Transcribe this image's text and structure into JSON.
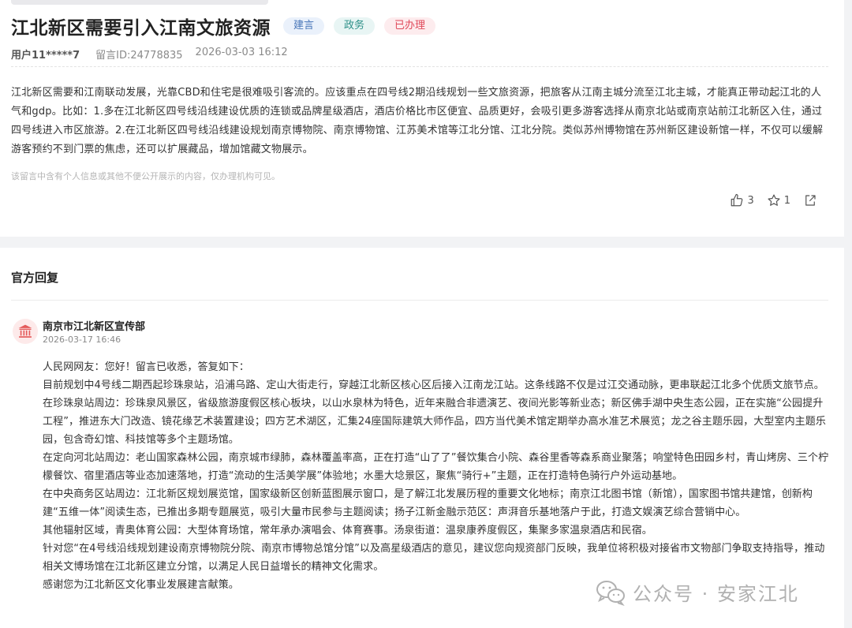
{
  "post": {
    "title": "江北新区需要引入江南文旅资源",
    "tags": [
      "建言",
      "政务",
      "已办理"
    ],
    "user": "用户11*****7",
    "message_id": "留言ID:24778835",
    "datetime": "2026-03-03 16:12",
    "content": "江北新区需要和江南联动发展，光靠CBD和住宅是很难吸引客流的。应该重点在四号线2期沿线规划一些文旅资源，把旅客从江南主城分流至江北主城，才能真正带动起江北的人气和gdp。比如：1.多在江北新区四号线沿线建设优质的连锁或品牌星级酒店，酒店价格比市区便宜、品质更好，会吸引更多游客选择从南京北站或南京站前江北新区入住，通过四号线进入市区旅游。2.在江北新区四号线沿线建设规划南京博物院、南京博物馆、江苏美术馆等江北分馆、江北分院。类似苏州博物馆在苏州新区建设新馆一样，不仅可以缓解游客预约不到门票的焦虑，还可以扩展藏品，增加馆藏文物展示。",
    "notice": "该留言中含有个人信息或其他不便公开展示的内容，仅办理机构可见。",
    "likes": "3",
    "favorites": "1"
  },
  "reply": {
    "section_title": "官方回复",
    "org": "南京市江北新区宣传部",
    "datetime": "2026-03-17 16:46",
    "paragraphs": [
      "人民网网友：您好！留言已收悉，答复如下：",
      "目前规划中4号线二期西起珍珠泉站，沿浦乌路、定山大街走行，穿越江北新区核心区后接入江南龙江站。这条线路不仅是过江交通动脉，更串联起江北多个优质文旅节点。",
      "在珍珠泉站周边：珍珠泉风景区，省级旅游度假区核心板块，以山水泉林为特色，近年来融合非遗演艺、夜间光影等新业态；新区佛手湖中央生态公园，正在实施“公园提升工程”，推进东大门改造、镜花缘艺术装置建设；四方艺术湖区，汇集24座国际建筑大师作品，四方当代美术馆定期举办高水准艺术展览；龙之谷主题乐园，大型室内主题乐园，包含奇幻馆、科技馆等多个主题场馆。",
      "在定向河北站周边：老山国家森林公园，南京城市绿肺，森林覆盖率高，正在打造“山了了”餐饮集合小院、森谷里香等森系商业聚落；响堂特色田园乡村，青山烤房、三个柠檬餐饮、宿里酒店等业态加速落地，打造“流动的生活美学展”体验地；水墨大埝景区，聚焦“骑行+”主题，正在打造特色骑行户外运动基地。",
      "在中央商务区站周边：江北新区规划展览馆，国家级新区创新蓝图展示窗口，是了解江北发展历程的重要文化地标；南京江北图书馆（新馆），国家图书馆共建馆，创新构建“五维一体”阅读生态，已推出多期专题展览，吸引大量市民参与主题阅读；扬子江新金融示范区：声湃音乐基地落户于此，打造文娱演艺综合营销中心。",
      "其他辐射区域，青奥体育公园：大型体育场馆，常年承办演唱会、体育赛事。汤泉街道：温泉康养度假区，集聚多家温泉酒店和民宿。",
      "针对您“在4号线沿线规划建设南京博物院分院、南京市博物总馆分馆”以及高星级酒店的意见，建议您向规资部门反映，我单位将积极对接省市文物部门争取支持指导，推动相关文博场馆在江北新区建立分馆，以满足人民日益增长的精神文化需求。",
      "感谢您为江北新区文化事业发展建言献策。"
    ]
  },
  "watermark": "公众号 · 安家江北"
}
